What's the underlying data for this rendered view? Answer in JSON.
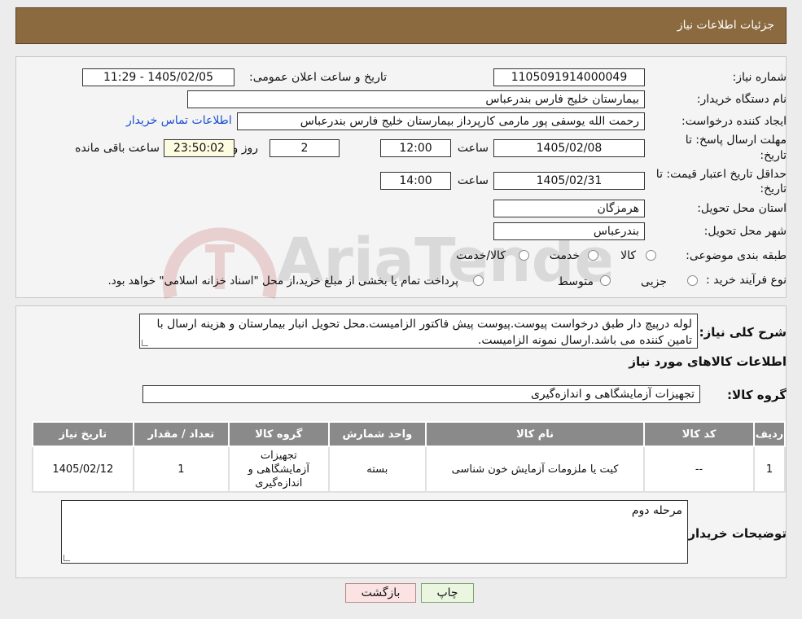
{
  "header": {
    "title": "جزئیات اطلاعات نیاز"
  },
  "need_number": {
    "label": "شماره نیاز:",
    "value": "1105091914000049"
  },
  "announce_datetime": {
    "label": "تاریخ و ساعت اعلان عمومی:",
    "value": "1405/02/05 - 11:29"
  },
  "buyer_org": {
    "label": "نام دستگاه خریدار:",
    "value": "بیمارستان خلیج فارس بندرعباس"
  },
  "requester": {
    "label": "ایجاد کننده درخواست:",
    "value": "رحمت الله یوسفی پور مارمی کارپرداز بیمارستان خلیج فارس بندرعباس",
    "contact_link": "اطلاعات تماس خریدار"
  },
  "reply_deadline": {
    "label_line1": "مهلت ارسال پاسخ: تا",
    "label_line2": "تاریخ:",
    "date": "1405/02/08",
    "time_label": "ساعت",
    "time": "12:00",
    "days": "2",
    "days_label": "روز و",
    "remaining": "23:50:02",
    "remaining_label": "ساعت باقی مانده"
  },
  "price_validity": {
    "label_line1": "حداقل تاریخ اعتبار قیمت: تا",
    "label_line2": "تاریخ:",
    "date": "1405/02/31",
    "time_label": "ساعت",
    "time": "14:00"
  },
  "delivery_province": {
    "label": "استان محل تحویل:",
    "value": "هرمزگان"
  },
  "delivery_city": {
    "label": "شهر محل تحویل:",
    "value": "بندرعباس"
  },
  "category": {
    "label": "طبقه بندی موضوعی:",
    "options": [
      "کالا",
      "خدمت",
      "کالا/خدمت"
    ]
  },
  "purchase_process": {
    "label": "نوع فرآیند خرید :",
    "options": [
      "جزیی",
      "متوسط"
    ],
    "note": "پرداخت تمام یا بخشی از مبلغ خرید،از محل \"اسناد خزانه اسلامی\" خواهد بود."
  },
  "description": {
    "label": "شرح کلی نیاز:",
    "text": "لوله درپیچ دار طبق درخواست پیوست.پیوست پیش فاکتور الزامیست.محل تحویل انبار بیمارستان و هزینه ارسال با تامین کننده می باشد.ارسال نمونه الزامیست."
  },
  "goods_info": {
    "title": "اطلاعات کالاهای مورد نیاز"
  },
  "goods_group": {
    "label": "گروه کالا:",
    "value": "تجهیزات آزمایشگاهی و اندازه‌گیری"
  },
  "table": {
    "headers": [
      "ردیف",
      "کد کالا",
      "نام کالا",
      "واحد شمارش",
      "گروه کالا",
      "تعداد / مقدار",
      "تاریخ نیاز"
    ],
    "rows": [
      [
        "1",
        "--",
        "کیت یا ملزومات آزمایش خون شناسی",
        "بسته",
        "تجهیزات آزمایشگاهی و اندازه‌گیری",
        "1",
        "1405/02/12"
      ]
    ]
  },
  "buyer_notes": {
    "label": "توضیحات خریدار:",
    "text": "مرحله دوم"
  },
  "buttons": {
    "print": "چاپ",
    "back": "بازگشت"
  },
  "watermark": {
    "text": "AriaTender.neT"
  },
  "colors": {
    "header": "#8c6a3f",
    "table_header": "#8a8a8a",
    "link": "#1a4fd0"
  }
}
